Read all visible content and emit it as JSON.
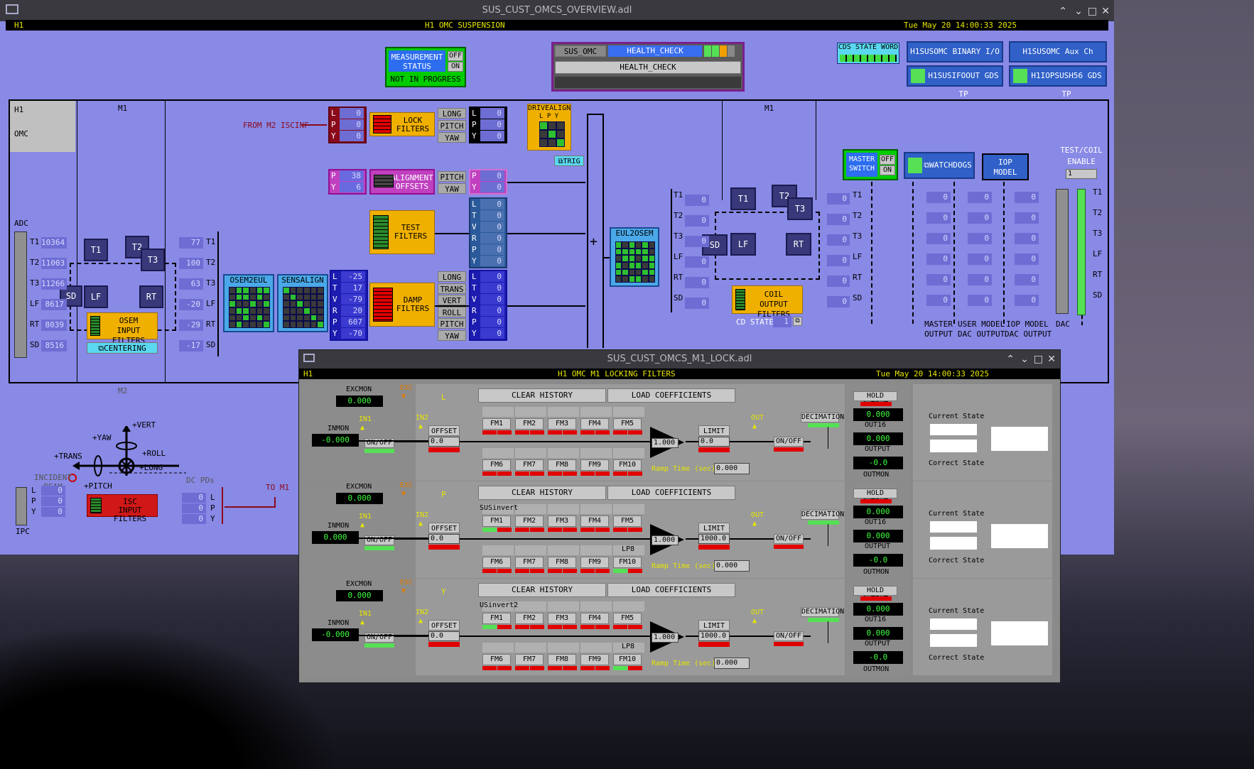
{
  "overview": {
    "window_title": "SUS_CUST_OMCS_OVERVIEW.adl",
    "ifo": "H1",
    "panel_title": "H1 OMC SUSPENSION",
    "datetime": "Tue May 20 14:00:33 2025",
    "measurement": {
      "label1": "MEASUREMENT",
      "label2": "STATUS",
      "off": "OFF",
      "on": "ON",
      "status": "NOT IN PROGRESS"
    },
    "health": {
      "sus": "SUS_OMC",
      "check": "HEALTH_CHECK",
      "menu": "HEALTH_CHECK"
    },
    "cds_state_word": "CDS STATE WORD",
    "binary_io": "H1SUSOMC BINARY I/O",
    "aux_ch": "H1SUSOMC Aux Ch",
    "gds_tp1": "H1SUSIFOOUT GDS TP",
    "gds_tp2": "H1IOPSUSH56 GDS TP",
    "h1": "H1",
    "omc": "OMC",
    "m1_left": "M1",
    "m1_right": "M1",
    "from_m2": "FROM M2 ISCINF",
    "adc": "ADC",
    "adc_labels": [
      "T1",
      "T2",
      "T3",
      "LF",
      "RT",
      "SD"
    ],
    "adc_values": [
      "10364",
      "11003",
      "11266",
      "8617",
      "8039",
      "8516"
    ],
    "sensors": {
      "t1": "T1",
      "t2": "T2",
      "t3": "T3",
      "sd": "SD",
      "lf": "LF",
      "rt": "RT"
    },
    "osem_input": {
      "l1": "OSEM",
      "l2": "INPUT FILTERS"
    },
    "centering": "CENTERING",
    "osem_out_labels": [
      "T1",
      "T2",
      "T3",
      "LF",
      "RT",
      "SD"
    ],
    "osem_out_values": [
      "77",
      "100",
      "63",
      "-20",
      "-29",
      "-17"
    ],
    "osem2eul": "OSEM2EUL",
    "sensalign": "SENSALIGN",
    "dof_labels": [
      "L",
      "T",
      "V",
      "R",
      "P",
      "Y"
    ],
    "dof_values": [
      "-25",
      "17",
      "-79",
      "20",
      "607",
      "-70"
    ],
    "lock_in_labels": [
      "L",
      "P",
      "Y"
    ],
    "lock_in_values": [
      "0",
      "0",
      "0"
    ],
    "lock_filters": {
      "l1": "LOCK",
      "l2": "FILTERS"
    },
    "lock_btns": [
      "LONG",
      "PITCH",
      "YAW"
    ],
    "lock_out_values": [
      "0",
      "0",
      "0"
    ],
    "drivealign": "DRIVEALIGN",
    "drivealign_lpy": "L P Y",
    "trig": "TRIG",
    "align_in_labels": [
      "P",
      "Y"
    ],
    "align_in_values": [
      "38",
      "6"
    ],
    "alignment": {
      "l1": "ALIGNMENT",
      "l2": "OFFSETS"
    },
    "align_btns": [
      "PITCH",
      "YAW"
    ],
    "align_out_values": [
      "0",
      "0"
    ],
    "test_filters": {
      "l1": "TEST",
      "l2": "FILTERS"
    },
    "test_out_values": [
      "0",
      "0",
      "0",
      "0",
      "0",
      "0"
    ],
    "damp_filters": {
      "l1": "DAMP",
      "l2": "FILTERS"
    },
    "damp_btns": [
      "LONG",
      "TRANS",
      "VERT",
      "ROLL",
      "PITCH",
      "YAW"
    ],
    "damp_out_values": [
      "0",
      "0",
      "0",
      "0",
      "0",
      "0"
    ],
    "eul2osem": "EUL2OSEM",
    "coil_labels": [
      "T1",
      "T2",
      "T3",
      "LF",
      "RT",
      "SD"
    ],
    "coil_values": [
      "0",
      "0",
      "0",
      "0",
      "0",
      "0"
    ],
    "coil_output": {
      "l1": "COIL",
      "l2": "OUTPUT FILTERS"
    },
    "cd_state": "CD STATE:",
    "cd_state_val": "1",
    "master_switch": {
      "l1": "MASTER",
      "l2": "SWITCH",
      "off": "OFF",
      "on": "ON"
    },
    "watchdogs": "WATCHDOGS",
    "iop_model": {
      "l1": "IOP",
      "l2": "MODEL"
    },
    "test_coil": {
      "l1": "TEST/COIL",
      "l2": "ENABLE",
      "val": "1"
    },
    "out_labels": [
      "T1",
      "T2",
      "T3",
      "LF",
      "RT",
      "SD"
    ],
    "cols": {
      "c0": [
        "0",
        "0",
        "0",
        "0",
        "0",
        "0"
      ],
      "master": [
        "0",
        "0",
        "0",
        "0",
        "0",
        "0"
      ],
      "user": [
        "0",
        "0",
        "0",
        "0",
        "0",
        "0"
      ],
      "iop": [
        "0",
        "0",
        "0",
        "0",
        "0",
        "0"
      ]
    },
    "col_labels": {
      "master1": "MASTER",
      "master2": "OUTPUT",
      "user1": "USER MODEL",
      "user2": "DAC OUTPUT",
      "iop1": "IOP MODEL",
      "iop2": "DAC OUTPUT",
      "dac": "DAC"
    },
    "m2": "M2",
    "dirs": {
      "vert": "+VERT",
      "yaw": "+YAW",
      "roll": "+ROLL",
      "trans": "+TRANS",
      "long": "+LONG",
      "pitch": "+PITCH"
    },
    "incident": {
      "l1": "INCIDENT",
      "l2": "BEAM"
    },
    "dc_pds": "DC PDs",
    "to_m1": "TO M1",
    "ipc": "IPC",
    "ipc_labels": [
      "L",
      "P",
      "Y"
    ],
    "ipc_values": [
      "0",
      "0",
      "0"
    ],
    "isc_filters": {
      "l1": "ISC",
      "l2": "INPUT FILTERS"
    },
    "isc_out_labels": [
      "L",
      "P",
      "Y"
    ],
    "isc_out_values": [
      "0",
      "0",
      "0"
    ]
  },
  "lock": {
    "window_title": "SUS_CUST_OMCS_M1_LOCK.adl",
    "ifo": "H1",
    "panel_title": "H1 OMC M1 LOCKING FILTERS",
    "datetime": "Tue May 20 14:00:33 2025",
    "labels": {
      "excmon": "EXCMON",
      "inmon": "INMON",
      "exc": "EXC",
      "in1": "IN1",
      "in2": "IN2",
      "on_off": "ON/OFF",
      "offset": "OFFSET",
      "clear": "CLEAR HISTORY",
      "load": "LOAD COEFFICIENTS",
      "limit": "LIMIT",
      "out": "OUT",
      "decimation": "DECIMATION",
      "hold": "HOLD OUTPUT",
      "out16": "OUT16",
      "output": "OUTPUT",
      "outmon": "OUTMON",
      "ramp": "Ramp Time (sec):",
      "current": "Current State",
      "correct": "Correct State"
    },
    "fm": [
      "FM1",
      "FM2",
      "FM3",
      "FM4",
      "FM5",
      "FM6",
      "FM7",
      "FM8",
      "FM9",
      "FM10"
    ],
    "rows": [
      {
        "name": "L",
        "excmon": "0.000",
        "inmon": "-0.000",
        "offset": "0.0",
        "gain": "1.000",
        "limit": "0.0",
        "ramp": "0.000",
        "out16": "0.000",
        "output": "0.000",
        "outmon": "-0.0",
        "fm1_label": "",
        "fm10_label": ""
      },
      {
        "name": "P",
        "excmon": "0.000",
        "inmon": "0.000",
        "offset": "0.0",
        "gain": "1.000",
        "limit": "1000.0",
        "ramp": "0.000",
        "out16": "0.000",
        "output": "0.000",
        "outmon": "-0.0",
        "fm1_label": "SUSinvert",
        "fm10_label": "LP8"
      },
      {
        "name": "Y",
        "excmon": "0.000",
        "inmon": "-0.000",
        "offset": "0.0",
        "gain": "1.000",
        "limit": "1000.0",
        "ramp": "0.000",
        "out16": "0.000",
        "output": "0.000",
        "outmon": "-0.0",
        "fm1_label": "USinvert2",
        "fm10_label": "LP8"
      }
    ]
  }
}
